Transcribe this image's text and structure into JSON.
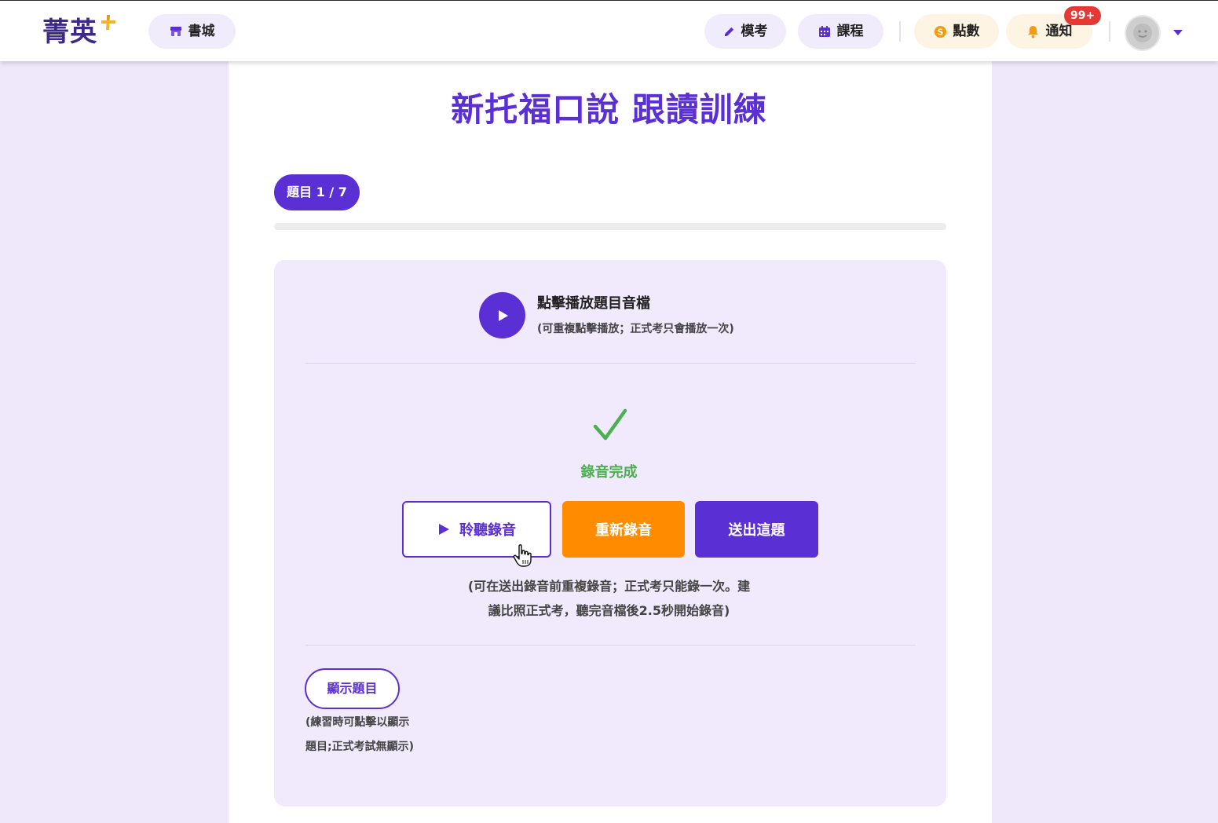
{
  "header": {
    "logo_text": "菁英",
    "store_label": "書城",
    "exam_label": "模考",
    "course_label": "課程",
    "points_label": "點數",
    "notify_label": "通知",
    "notify_badge": "99+"
  },
  "main": {
    "title": "新托福口說 跟讀訓練",
    "question_badge": "題目 1 / 7",
    "progress_fraction": 0,
    "audio": {
      "title": "點擊播放題目音檔",
      "hint": "(可重複點擊播放；正式考只會播放一次)"
    },
    "status_text": "錄音完成",
    "buttons": {
      "listen": "聆聽錄音",
      "rerecord": "重新錄音",
      "submit": "送出這題"
    },
    "record_hint_line1": "(可在送出錄音前重複錄音；正式考只能錄一次。建",
    "record_hint_line2": "議比照正式考，聽完音檔後2.5秒開始錄音)",
    "show_question": {
      "label": "顯示題目",
      "hint_line1": "(練習時可點擊以顯示",
      "hint_line2": "題目;正式考試無顯示)"
    }
  },
  "colors": {
    "brand": "#5a2fd4",
    "orange": "#ff8c00",
    "success": "#4caf50",
    "badge_red": "#e53935"
  },
  "icons": [
    "store-icon",
    "pencil-icon",
    "calendar-icon",
    "coin-icon",
    "bell-icon",
    "avatar-icon",
    "caret-down-icon",
    "play-icon",
    "checkmark-icon",
    "pointer-cursor-icon"
  ]
}
